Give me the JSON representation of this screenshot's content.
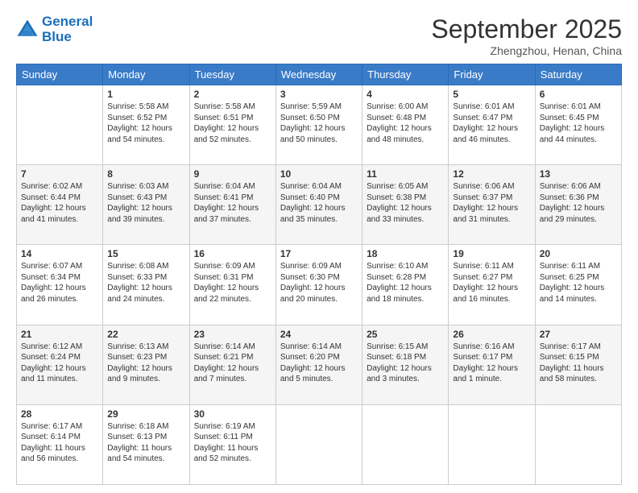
{
  "header": {
    "logo_line1": "General",
    "logo_line2": "Blue",
    "month": "September 2025",
    "location": "Zhengzhou, Henan, China"
  },
  "days_of_week": [
    "Sunday",
    "Monday",
    "Tuesday",
    "Wednesday",
    "Thursday",
    "Friday",
    "Saturday"
  ],
  "weeks": [
    [
      {
        "day": "",
        "info": ""
      },
      {
        "day": "1",
        "info": "Sunrise: 5:58 AM\nSunset: 6:52 PM\nDaylight: 12 hours\nand 54 minutes."
      },
      {
        "day": "2",
        "info": "Sunrise: 5:58 AM\nSunset: 6:51 PM\nDaylight: 12 hours\nand 52 minutes."
      },
      {
        "day": "3",
        "info": "Sunrise: 5:59 AM\nSunset: 6:50 PM\nDaylight: 12 hours\nand 50 minutes."
      },
      {
        "day": "4",
        "info": "Sunrise: 6:00 AM\nSunset: 6:48 PM\nDaylight: 12 hours\nand 48 minutes."
      },
      {
        "day": "5",
        "info": "Sunrise: 6:01 AM\nSunset: 6:47 PM\nDaylight: 12 hours\nand 46 minutes."
      },
      {
        "day": "6",
        "info": "Sunrise: 6:01 AM\nSunset: 6:45 PM\nDaylight: 12 hours\nand 44 minutes."
      }
    ],
    [
      {
        "day": "7",
        "info": "Sunrise: 6:02 AM\nSunset: 6:44 PM\nDaylight: 12 hours\nand 41 minutes."
      },
      {
        "day": "8",
        "info": "Sunrise: 6:03 AM\nSunset: 6:43 PM\nDaylight: 12 hours\nand 39 minutes."
      },
      {
        "day": "9",
        "info": "Sunrise: 6:04 AM\nSunset: 6:41 PM\nDaylight: 12 hours\nand 37 minutes."
      },
      {
        "day": "10",
        "info": "Sunrise: 6:04 AM\nSunset: 6:40 PM\nDaylight: 12 hours\nand 35 minutes."
      },
      {
        "day": "11",
        "info": "Sunrise: 6:05 AM\nSunset: 6:38 PM\nDaylight: 12 hours\nand 33 minutes."
      },
      {
        "day": "12",
        "info": "Sunrise: 6:06 AM\nSunset: 6:37 PM\nDaylight: 12 hours\nand 31 minutes."
      },
      {
        "day": "13",
        "info": "Sunrise: 6:06 AM\nSunset: 6:36 PM\nDaylight: 12 hours\nand 29 minutes."
      }
    ],
    [
      {
        "day": "14",
        "info": "Sunrise: 6:07 AM\nSunset: 6:34 PM\nDaylight: 12 hours\nand 26 minutes."
      },
      {
        "day": "15",
        "info": "Sunrise: 6:08 AM\nSunset: 6:33 PM\nDaylight: 12 hours\nand 24 minutes."
      },
      {
        "day": "16",
        "info": "Sunrise: 6:09 AM\nSunset: 6:31 PM\nDaylight: 12 hours\nand 22 minutes."
      },
      {
        "day": "17",
        "info": "Sunrise: 6:09 AM\nSunset: 6:30 PM\nDaylight: 12 hours\nand 20 minutes."
      },
      {
        "day": "18",
        "info": "Sunrise: 6:10 AM\nSunset: 6:28 PM\nDaylight: 12 hours\nand 18 minutes."
      },
      {
        "day": "19",
        "info": "Sunrise: 6:11 AM\nSunset: 6:27 PM\nDaylight: 12 hours\nand 16 minutes."
      },
      {
        "day": "20",
        "info": "Sunrise: 6:11 AM\nSunset: 6:25 PM\nDaylight: 12 hours\nand 14 minutes."
      }
    ],
    [
      {
        "day": "21",
        "info": "Sunrise: 6:12 AM\nSunset: 6:24 PM\nDaylight: 12 hours\nand 11 minutes."
      },
      {
        "day": "22",
        "info": "Sunrise: 6:13 AM\nSunset: 6:23 PM\nDaylight: 12 hours\nand 9 minutes."
      },
      {
        "day": "23",
        "info": "Sunrise: 6:14 AM\nSunset: 6:21 PM\nDaylight: 12 hours\nand 7 minutes."
      },
      {
        "day": "24",
        "info": "Sunrise: 6:14 AM\nSunset: 6:20 PM\nDaylight: 12 hours\nand 5 minutes."
      },
      {
        "day": "25",
        "info": "Sunrise: 6:15 AM\nSunset: 6:18 PM\nDaylight: 12 hours\nand 3 minutes."
      },
      {
        "day": "26",
        "info": "Sunrise: 6:16 AM\nSunset: 6:17 PM\nDaylight: 12 hours\nand 1 minute."
      },
      {
        "day": "27",
        "info": "Sunrise: 6:17 AM\nSunset: 6:15 PM\nDaylight: 11 hours\nand 58 minutes."
      }
    ],
    [
      {
        "day": "28",
        "info": "Sunrise: 6:17 AM\nSunset: 6:14 PM\nDaylight: 11 hours\nand 56 minutes."
      },
      {
        "day": "29",
        "info": "Sunrise: 6:18 AM\nSunset: 6:13 PM\nDaylight: 11 hours\nand 54 minutes."
      },
      {
        "day": "30",
        "info": "Sunrise: 6:19 AM\nSunset: 6:11 PM\nDaylight: 11 hours\nand 52 minutes."
      },
      {
        "day": "",
        "info": ""
      },
      {
        "day": "",
        "info": ""
      },
      {
        "day": "",
        "info": ""
      },
      {
        "day": "",
        "info": ""
      }
    ]
  ]
}
